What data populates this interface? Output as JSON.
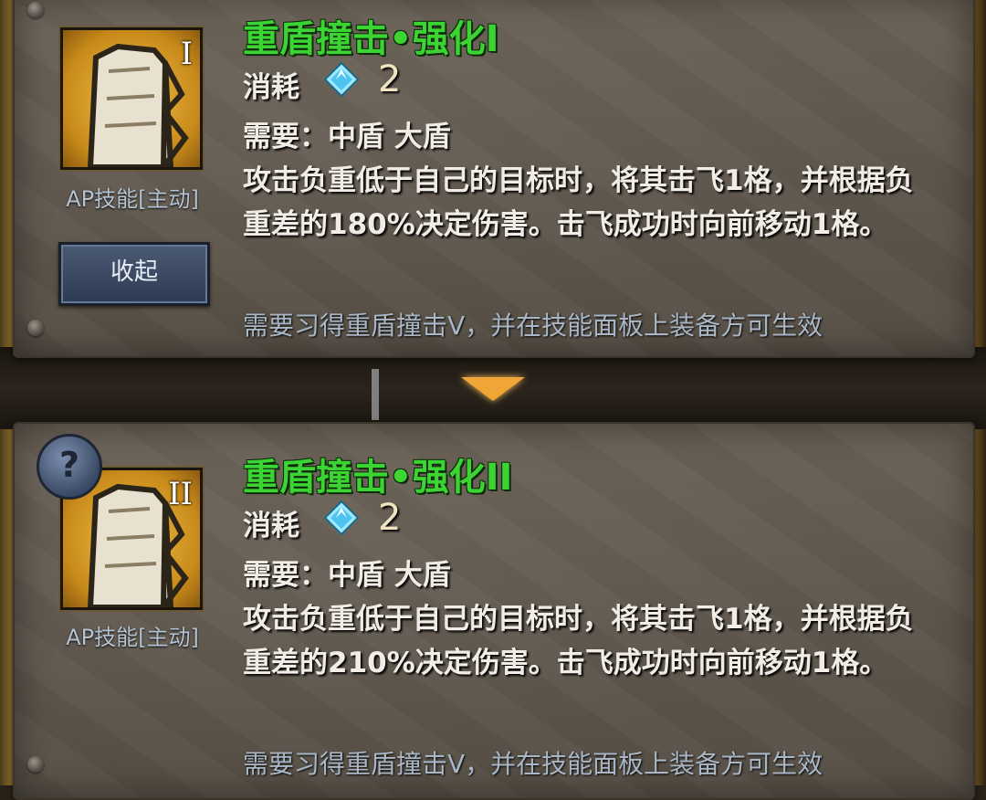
{
  "skills": [
    {
      "roman": "I",
      "title": "重盾撞击•强化I",
      "cost_label": "消耗",
      "cost_value": "2",
      "requirement": "需要：中盾  大盾",
      "description": "攻击负重低于自己的目标时，将其击飞1格，并根据负重差的180%决定伤害。击飞成功时向前移动1格。",
      "tag": "AP技能[主动]",
      "note": "需要习得重盾撞击V，并在技能面板上装备方可生效",
      "icon": "shield-bash-icon"
    },
    {
      "roman": "II",
      "title": "重盾撞击•强化II",
      "cost_label": "消耗",
      "cost_value": "2",
      "requirement": "需要：中盾  大盾",
      "description": "攻击负重低于自己的目标时，将其击飞1格，并根据负重差的210%决定伤害。击飞成功时向前移动1格。",
      "tag": "AP技能[主动]",
      "note": "需要习得重盾撞击V，并在技能面板上装备方可生效",
      "icon": "shield-bash-icon"
    }
  ],
  "buttons": {
    "collapse_label": "收起",
    "help_label": "?"
  },
  "icons": {
    "cost": "crystal-gem-icon",
    "expand": "triangle-down-icon"
  },
  "colors": {
    "title": "#3cd432",
    "note": "#a9b6c6",
    "arrow": "#f0a636"
  }
}
